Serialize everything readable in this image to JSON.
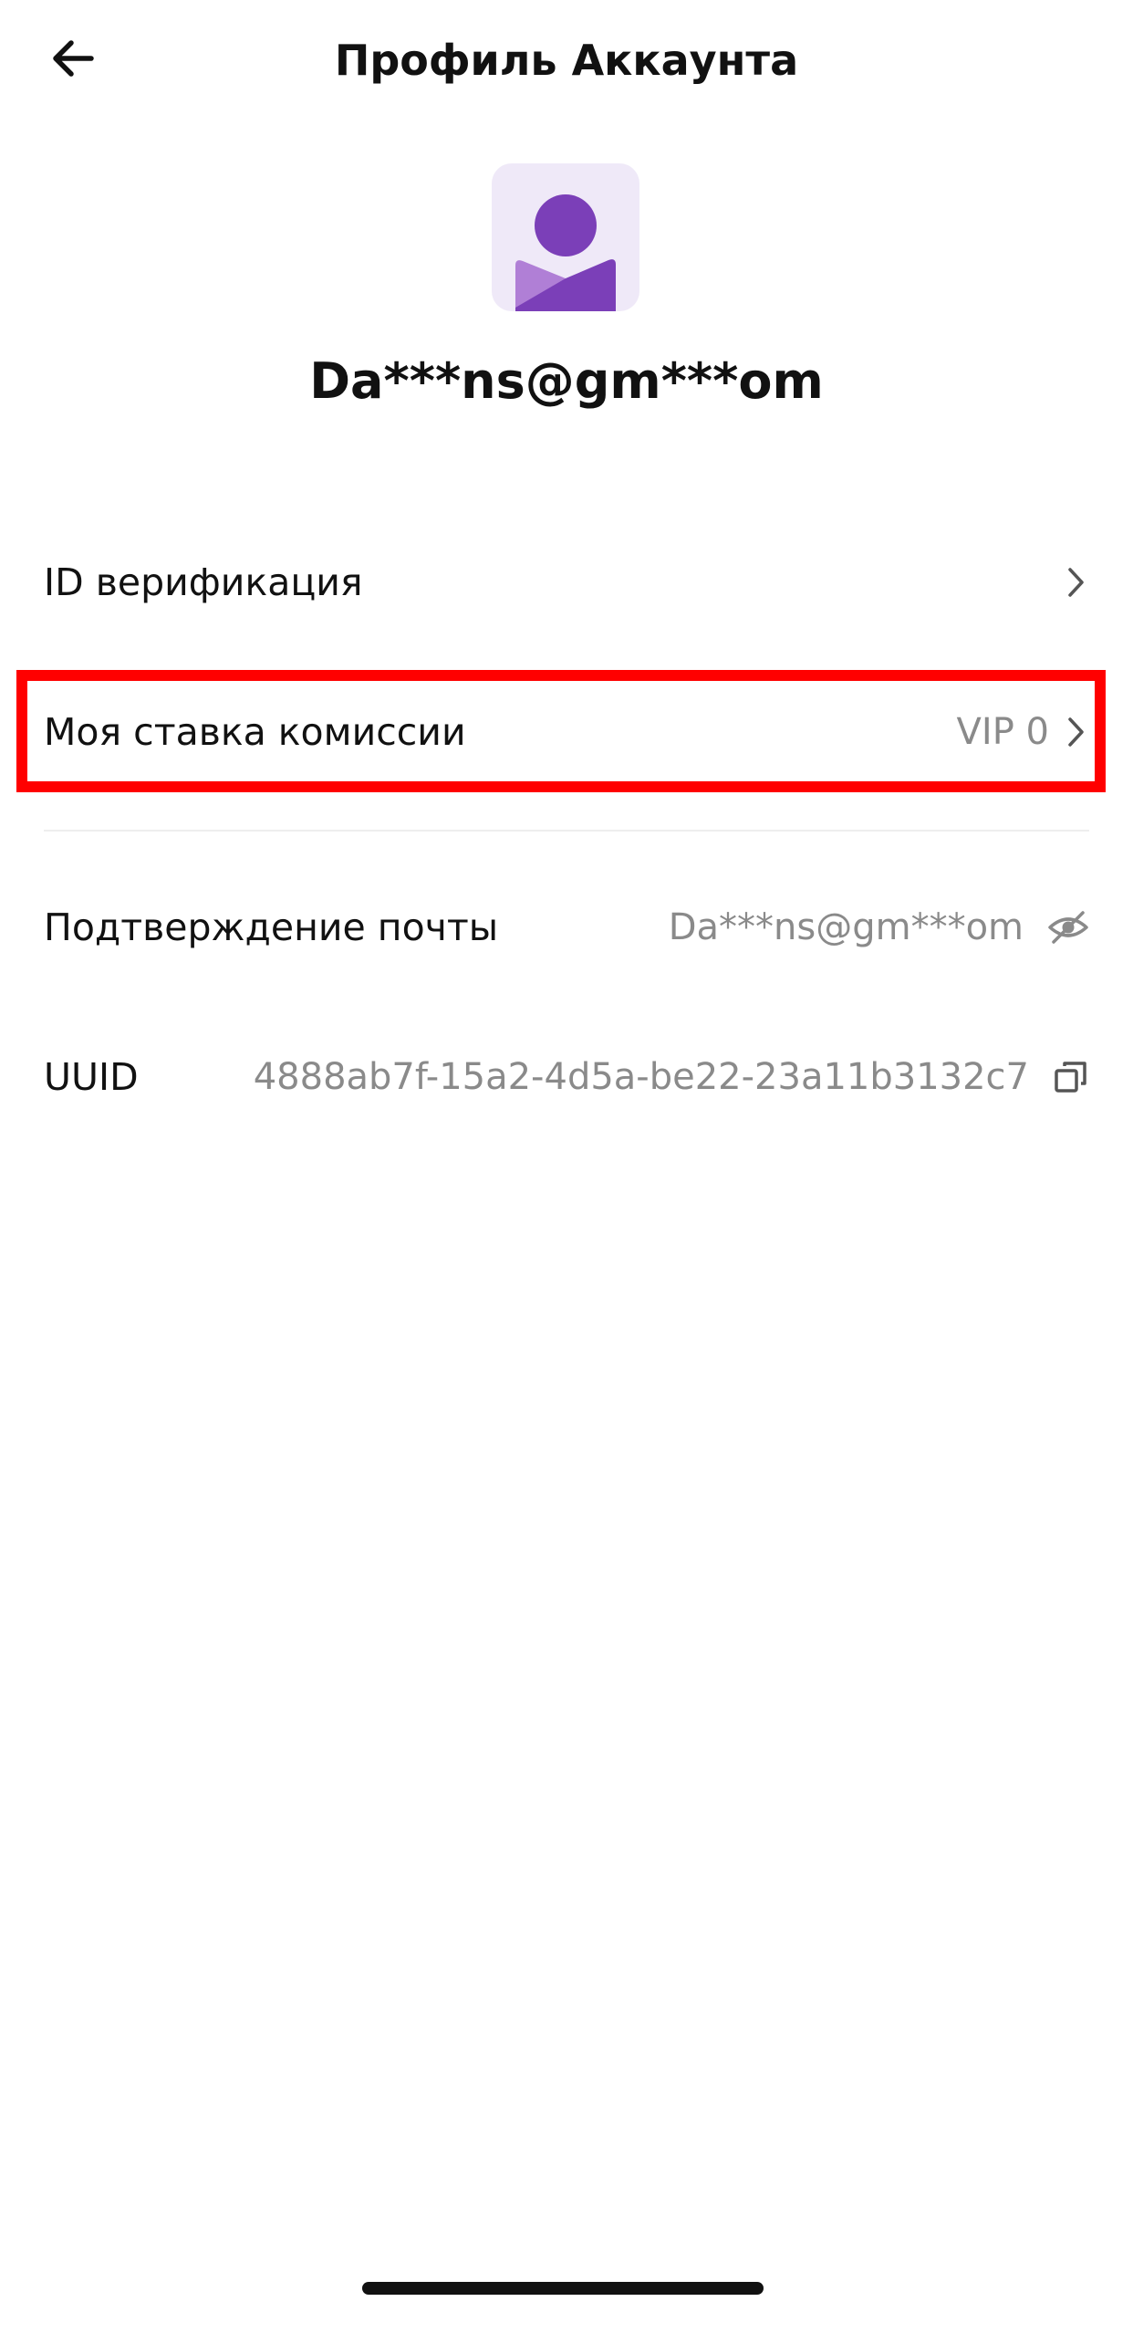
{
  "header": {
    "title": "Профиль Аккаунта",
    "back_icon": "arrow-left-icon"
  },
  "profile": {
    "avatar_icon": "user-avatar-icon",
    "account_name": "Da***ns@gm***om",
    "avatar_bg_color": "#efe9f8",
    "avatar_fg_color": "#7b3fb8"
  },
  "rows": {
    "verification": {
      "label": "ID верификация",
      "icon": "chevron-right-icon"
    },
    "commission": {
      "label": "Моя ставка комиссии",
      "value": "VIP 0",
      "icon": "chevron-right-icon"
    },
    "email": {
      "label": "Подтверждение почты",
      "value": "Da***ns@gm***om",
      "icon": "eye-off-icon"
    },
    "uuid": {
      "label": "UUID",
      "value": "4888ab7f-15a2-4d5a-be22-23a11b3132c7",
      "icon": "copy-icon"
    }
  },
  "colors": {
    "highlight": "#ff0000",
    "secondary_text": "#8a8a8a",
    "primary_text": "#111111"
  }
}
